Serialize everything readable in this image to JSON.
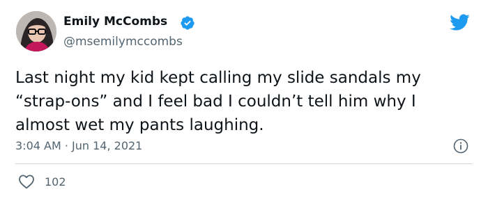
{
  "author": {
    "name": "Emily McCombs",
    "handle": "@msemilymccombs",
    "avatar": "profile-photo",
    "verified_icon": "verified-badge-icon"
  },
  "tweet": {
    "text": "Last night my kid kept calling my slide sandals my\n“strap-ons” and I feel bad I couldn’t tell him why I\nalmost wet my pants laughing.",
    "timestamp": "3:04 AM · Jun 14, 2021",
    "likes": "102"
  },
  "icons": {
    "platform": "twitter-bird-icon",
    "info": "info-icon",
    "like": "heart-icon"
  },
  "colors": {
    "brand": "#1d9bf0",
    "text": "#0f1419",
    "muted": "#536471",
    "divider": "#cfd9de"
  }
}
